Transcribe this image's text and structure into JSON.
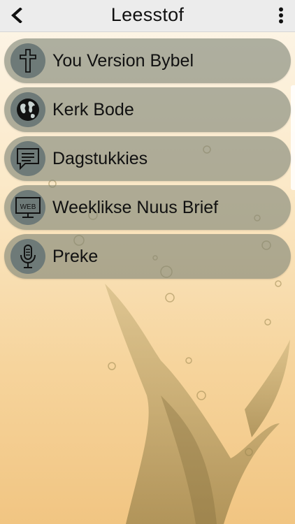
{
  "header": {
    "title": "Leesstof",
    "back_icon": "chevron-left-icon",
    "menu_icon": "more-vert-icon"
  },
  "items": [
    {
      "label": "You Version Bybel",
      "icon": "cross-icon"
    },
    {
      "label": "Kerk Bode",
      "icon": "globe-icon"
    },
    {
      "label": "Dagstukkies",
      "icon": "chat-bubble-icon"
    },
    {
      "label": "Weeklikse Nuus Brief",
      "icon": "web-monitor-icon",
      "icon_text": "WEB"
    },
    {
      "label": "Preke",
      "icon": "microphone-icon"
    }
  ],
  "colors": {
    "header_bg": "#ececec",
    "item_bg": "#7e8476",
    "icon_bg": "#6e7a78",
    "background_top": "#fdf6ea",
    "background_bottom": "#f1c582"
  }
}
